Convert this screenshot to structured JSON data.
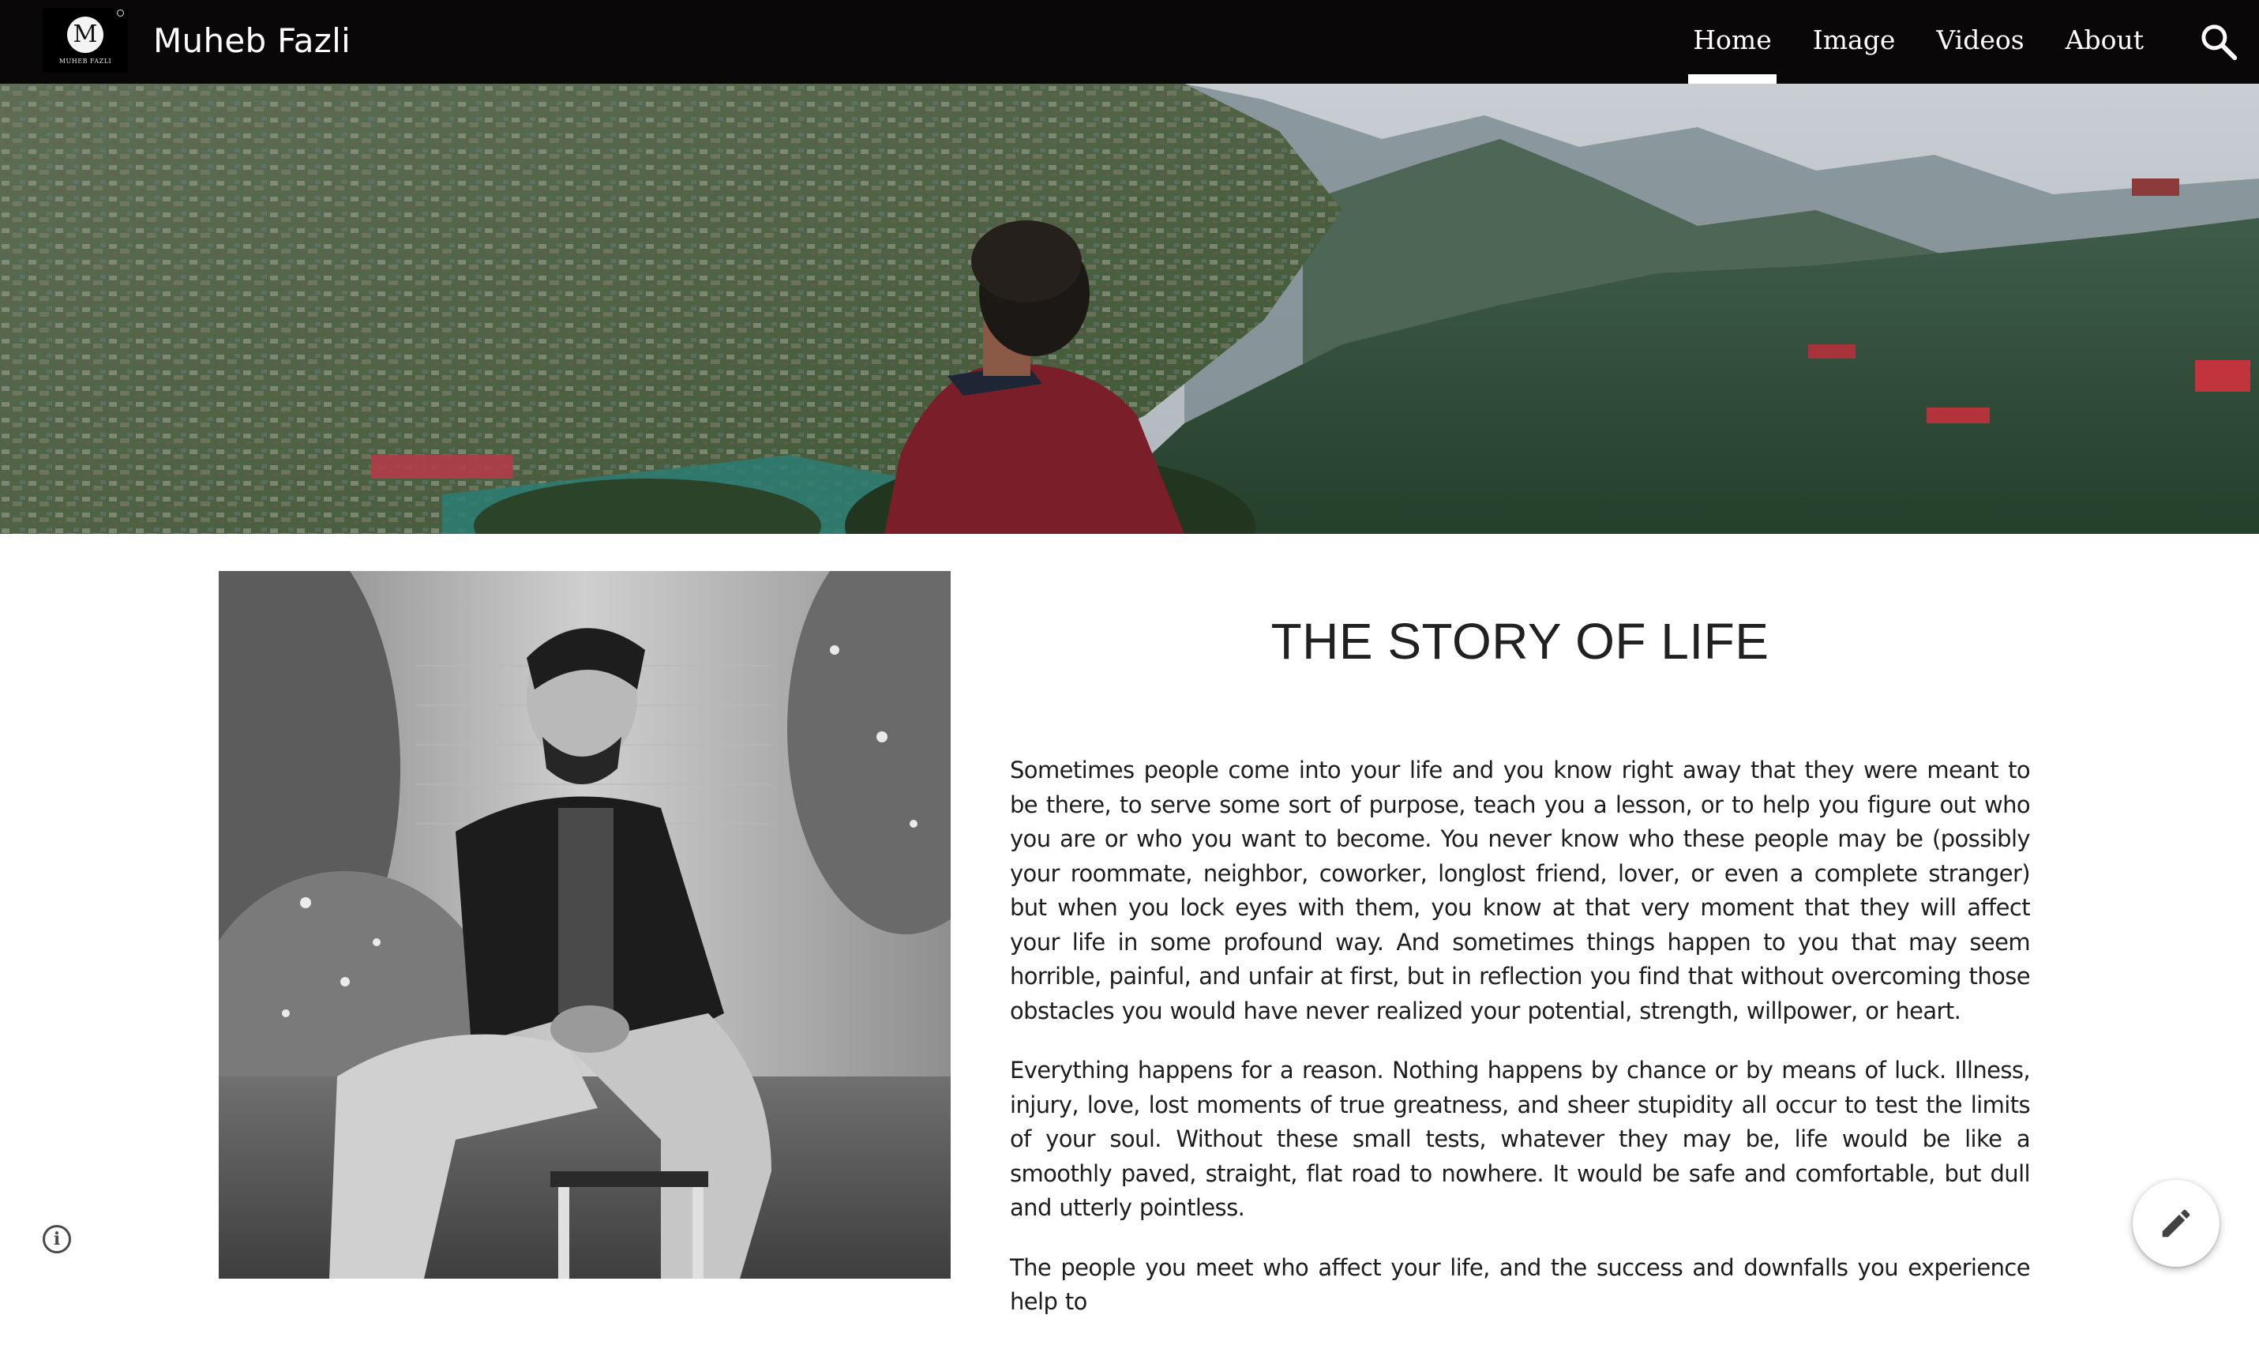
{
  "site": {
    "logo_letter": "M",
    "logo_text": "MUHEB FAZLI",
    "title": "Muheb Fazli"
  },
  "nav": {
    "items": [
      {
        "label": "Home",
        "active": true
      },
      {
        "label": "Image",
        "active": false
      },
      {
        "label": "Videos",
        "active": false
      },
      {
        "label": "About",
        "active": false
      }
    ],
    "search_icon": "search-icon"
  },
  "story": {
    "title": "THE STORY OF LIFE",
    "paragraphs": [
      "Sometimes people come into your life and you know right away that they were meant to be there, to serve some sort of purpose, teach you a lesson, or to help you figure out who you are or who you want to become. You never know who these people may be (possibly your roommate, neighbor, coworker, longlost friend, lover, or even a complete stranger) but when you lock eyes with them, you know at that very moment that they will affect your life in some profound way. And sometimes things happen to you that may seem horrible, painful, and unfair at first, but in reflection you find that without overcoming those obstacles you would have never realized your potential, strength, willpower, or heart.",
      "Everything happens for a reason. Nothing happens by chance or by means of luck. Illness, injury, love, lost moments of true greatness, and sheer stupidity all occur to test the limits of your soul. Without these small tests, whatever they may be, life would be like a smoothly paved, straight, flat road to nowhere. It would be safe and comfortable, but dull and utterly pointless.",
      "The people you meet who affect your life, and the success and downfalls you experience help to"
    ]
  },
  "controls": {
    "info_icon": "info-icon",
    "edit_icon": "pencil-icon"
  },
  "colors": {
    "topbar_bg": "#0a0709",
    "nav_text": "#ffffff",
    "body_text": "#1d1d1d",
    "heading_text": "#212121"
  }
}
